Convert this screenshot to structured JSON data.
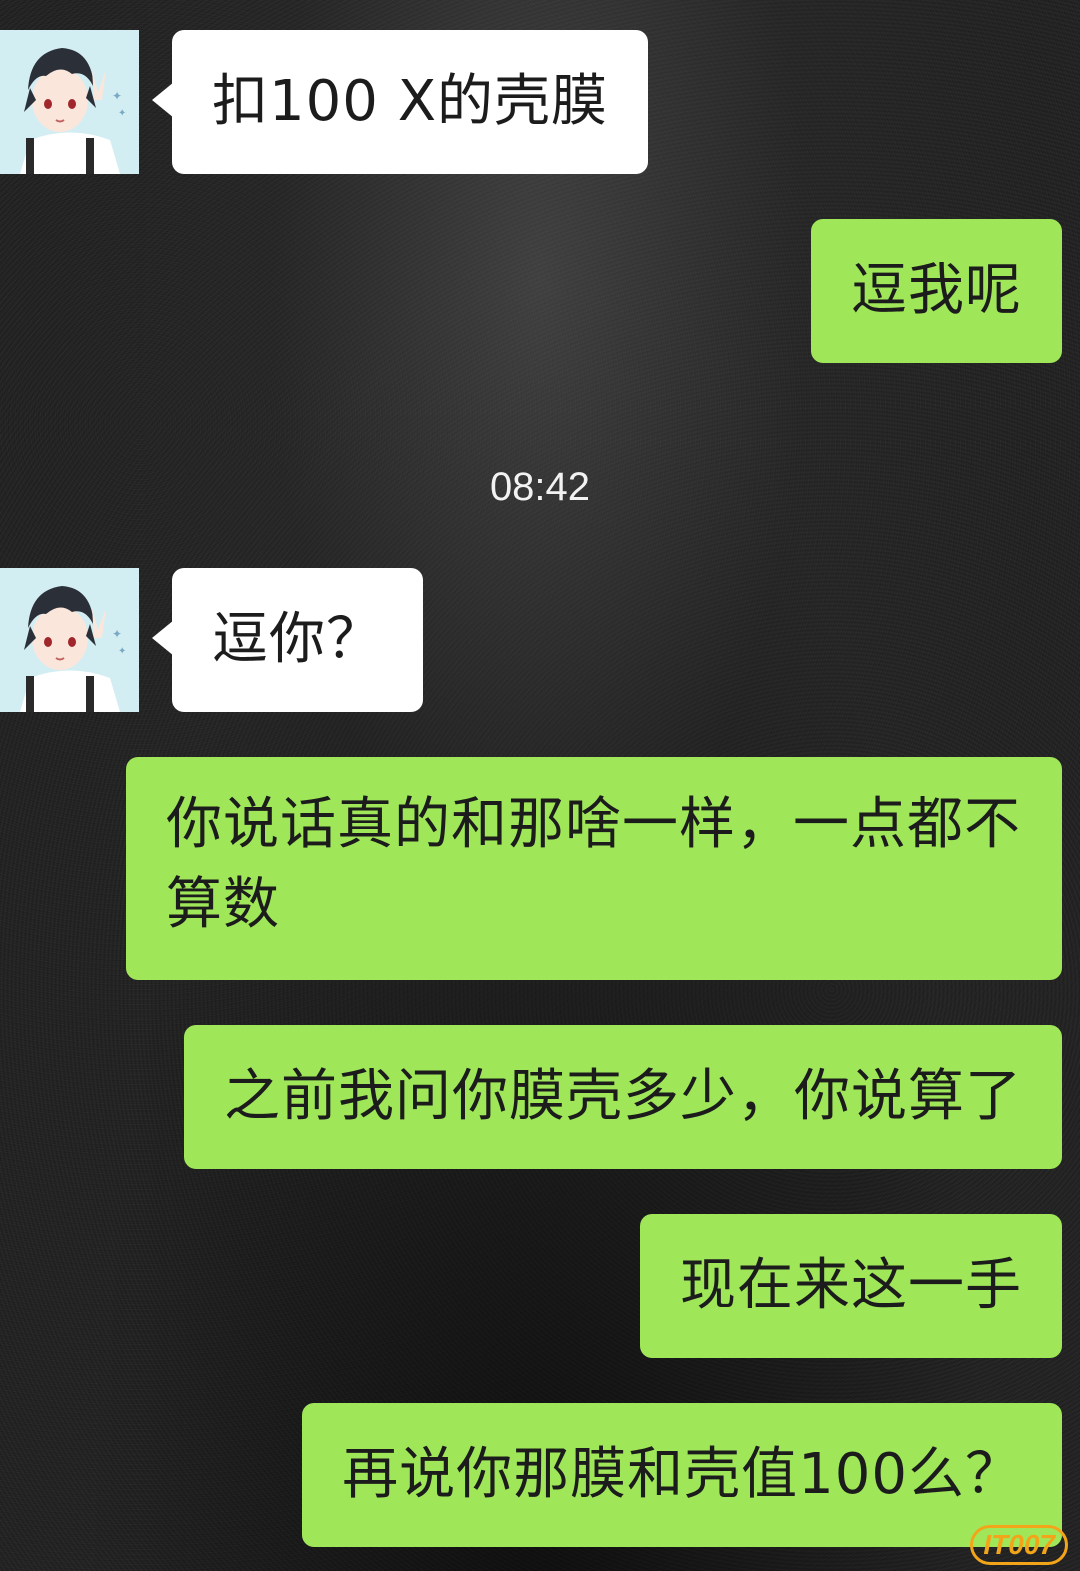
{
  "timestamp": "08:42",
  "watermark": "IT007",
  "messages": [
    {
      "side": "received",
      "text": "扣100 X的壳膜"
    },
    {
      "side": "sent",
      "text": "逗我呢"
    },
    {
      "side": "received",
      "text": "逗你？"
    },
    {
      "side": "sent",
      "text": "你说话真的和那啥一样，一点都不算数"
    },
    {
      "side": "sent",
      "text": "之前我问你膜壳多少，你说算了"
    },
    {
      "side": "sent",
      "text": "现在来这一手"
    },
    {
      "side": "sent",
      "text": "再说你那膜和壳值100么？"
    }
  ],
  "colors": {
    "sent_bubble": "#9fe759",
    "received_bubble": "#ffffff",
    "timestamp_text": "#f2f2f2",
    "watermark": "#f3a51a"
  },
  "icons": {
    "avatar": "anime-boy-avatar-icon"
  }
}
